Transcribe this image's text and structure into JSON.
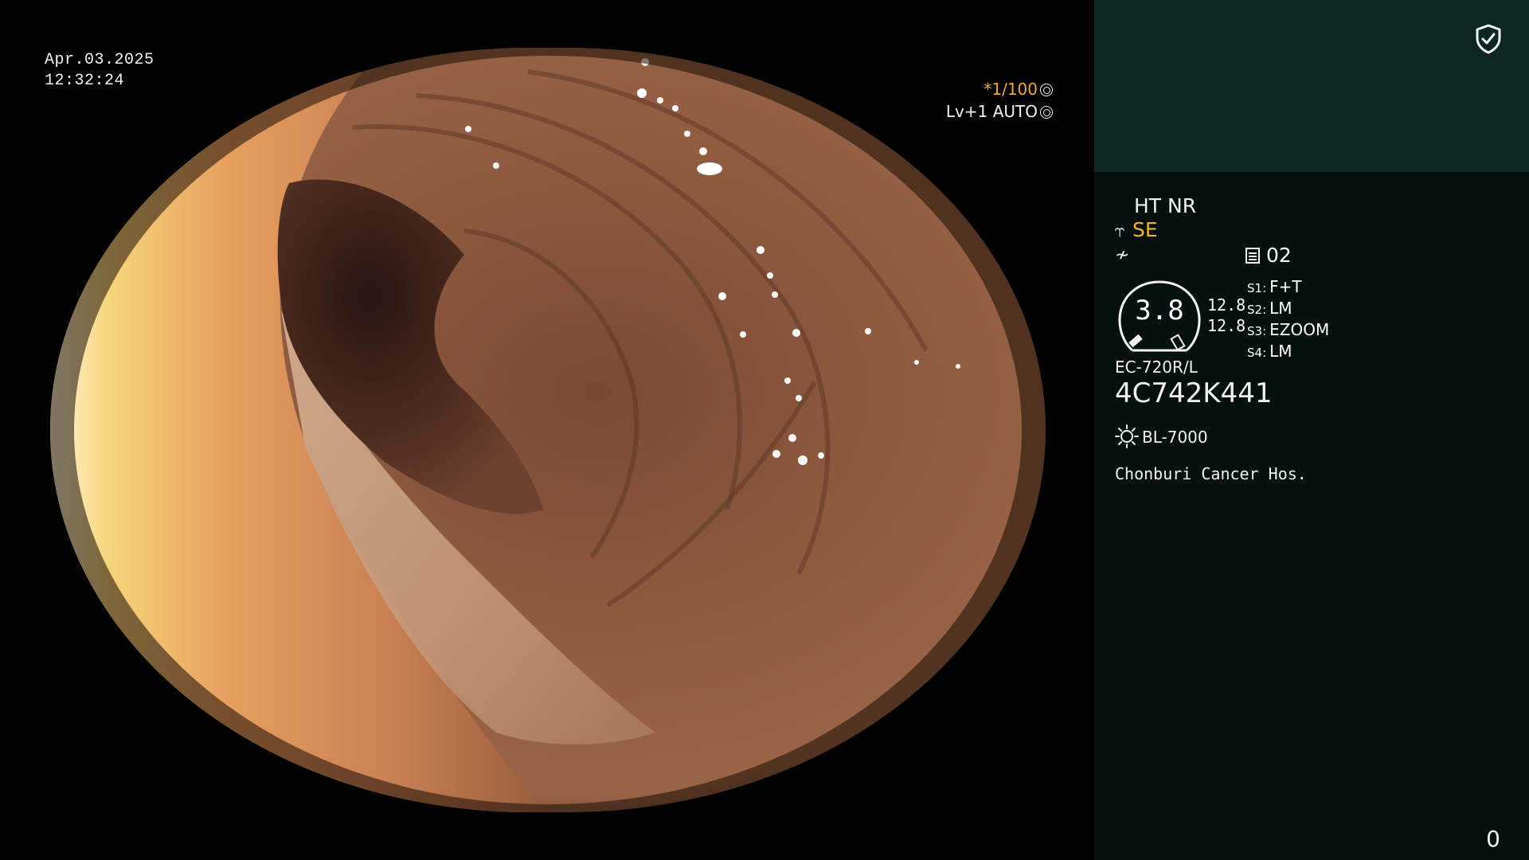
{
  "image": {
    "date": "Apr.03.2025",
    "time": "12:32:24",
    "shutter_speed": "*1/100",
    "exposure_mode": "Lv+1 AUTO"
  },
  "panel": {
    "ht_nr": "HT NR",
    "se_label": "SE",
    "record_number": "02",
    "gauge_value": "3.8",
    "size_1": "12.8",
    "size_2": "12.8",
    "switches": [
      {
        "key": "S1:",
        "value": "F+T"
      },
      {
        "key": "S2:",
        "value": "LM"
      },
      {
        "key": "S3:",
        "value": "EZOOM"
      },
      {
        "key": "S4:",
        "value": "LM"
      }
    ],
    "scope_model": "EC-720R/L",
    "serial_number": "4C742K441",
    "light_source": "BL-7000",
    "hospital": "Chonburi Cancer Hos.",
    "counter": "0"
  },
  "icons": {
    "shield": "shield-check-icon",
    "se": "scope-icon",
    "f": "not-equal-icon",
    "record": "document-icon",
    "light": "sun-icon",
    "shutter": "aperture-icon"
  },
  "colors": {
    "panel_top": "#0c2525",
    "panel": "#061010",
    "accent_orange": "#f0a83a"
  }
}
